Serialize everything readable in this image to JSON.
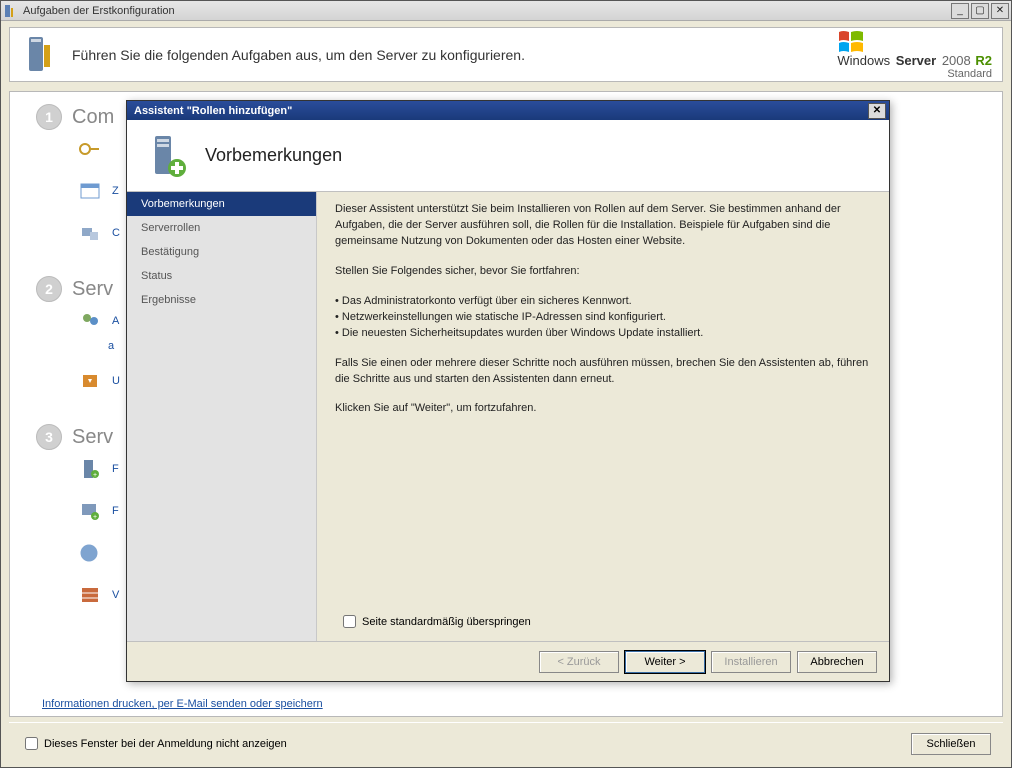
{
  "bgWindow": {
    "title": "Aufgaben der Erstkonfiguration",
    "headerText": "Führen Sie die folgenden Aufgaben aus, um den Server zu konfigurieren.",
    "brand": {
      "word1": "Windows",
      "word2": "Server",
      "word3": "2008",
      "word4": "R2",
      "edition": "Standard"
    },
    "sections": {
      "s1": {
        "label": "Com"
      },
      "s2": {
        "label": "Serv"
      },
      "s3": {
        "label": "Serv"
      }
    },
    "items": {
      "i1": "",
      "i2": "Z",
      "i3": "C",
      "i4": "A",
      "i5": "a",
      "i6": "U",
      "i7": "F",
      "i8": "F",
      "i9": "",
      "i10": "V"
    },
    "bottomLink": "Informationen drucken, per E-Mail senden oder speichern",
    "footer": {
      "checkboxLabel": "Dieses Fenster bei der Anmeldung nicht anzeigen",
      "closeLabel": "Schließen"
    }
  },
  "wizard": {
    "title": "Assistent \"Rollen hinzufügen\"",
    "headerTitle": "Vorbemerkungen",
    "sidebar": {
      "items": [
        "Vorbemerkungen",
        "Serverrollen",
        "Bestätigung",
        "Status",
        "Ergebnisse"
      ]
    },
    "content": {
      "p1": "Dieser Assistent unterstützt Sie beim Installieren von Rollen auf dem Server. Sie bestimmen anhand der Aufgaben, die der Server ausführen soll, die Rollen für die Installation. Beispiele für Aufgaben sind die gemeinsame Nutzung von Dokumenten oder das Hosten einer Website.",
      "p2": "Stellen Sie Folgendes sicher, bevor Sie fortfahren:",
      "bullets": [
        "Das Administratorkonto verfügt über ein sicheres Kennwort.",
        "Netzwerkeinstellungen wie statische IP-Adressen sind konfiguriert.",
        "Die neuesten Sicherheitsupdates wurden über Windows Update installiert."
      ],
      "p3": "Falls Sie einen oder mehrere dieser Schritte noch ausführen müssen, brechen Sie den Assistenten ab, führen die Schritte aus und starten den Assistenten dann erneut.",
      "p4": "Klicken Sie auf \"Weiter\", um fortzufahren.",
      "skipLabel": "Seite standardmäßig überspringen"
    },
    "buttons": {
      "back": "< Zurück",
      "next": "Weiter >",
      "install": "Installieren",
      "cancel": "Abbrechen"
    }
  }
}
